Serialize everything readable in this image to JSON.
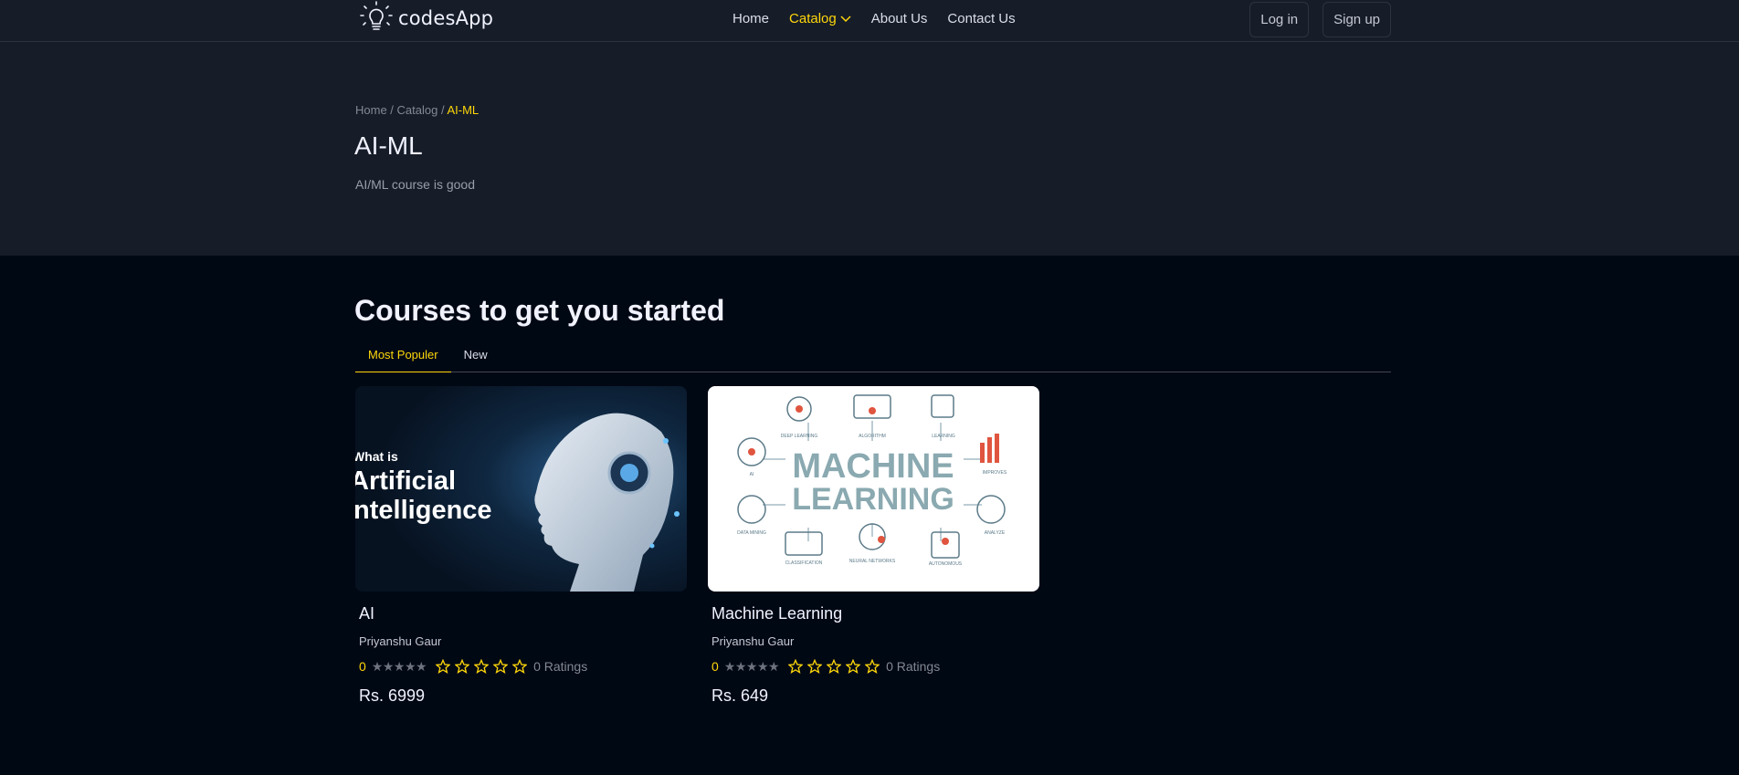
{
  "brand": {
    "name": "codesApp",
    "accent": "#FFD60A"
  },
  "nav": {
    "links": [
      "Home",
      "Catalog",
      "About Us",
      "Contact Us"
    ],
    "login": "Log in",
    "signup": "Sign up"
  },
  "breadcrumb": {
    "home": "Home",
    "catalog": "Catalog",
    "current": "AI-ML",
    "separator": " / "
  },
  "hero": {
    "title": "AI-ML",
    "description": "AI/ML course is good"
  },
  "section": {
    "title": "Courses to get you started",
    "tabs": [
      "Most Populer",
      "New"
    ]
  },
  "courses": [
    {
      "title": "AI",
      "author": "Priyanshu Gaur",
      "rating": "0",
      "ratings_label": "0 Ratings",
      "price": "Rs. 6999",
      "thumb_line1": "What is",
      "thumb_line2": "Artificial",
      "thumb_line3": "Intelligence"
    },
    {
      "title": "Machine Learning",
      "author": "Priyanshu Gaur",
      "rating": "0",
      "ratings_label": "0 Ratings",
      "price": "Rs. 649",
      "thumb_line1": "MACHINE",
      "thumb_line2": "LEARNING",
      "thumb_labels": [
        "DEEP LEARNING",
        "ALGORITHM",
        "LEARNING",
        "AI",
        "IMPROVES",
        "DATA MINING",
        "ANALYZE",
        "CLASSIFICATION",
        "NEURAL NETWORKS",
        "AUTONOMOUS"
      ]
    }
  ]
}
